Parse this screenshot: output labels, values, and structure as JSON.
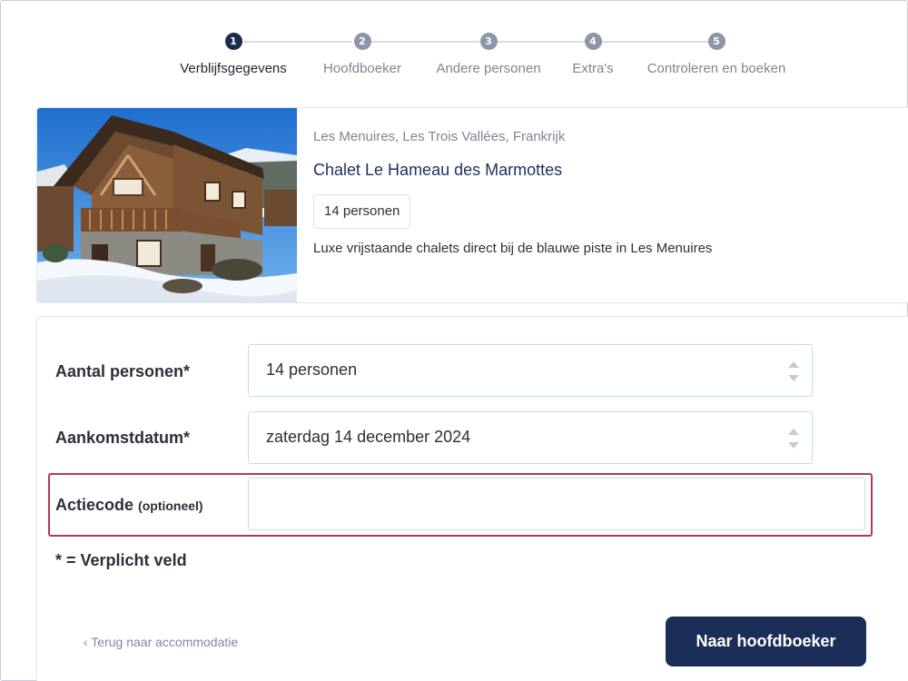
{
  "stepper": {
    "steps": [
      {
        "number": "1",
        "label": "Verblijfsgegevens",
        "active": true
      },
      {
        "number": "2",
        "label": "Hoofdboeker",
        "active": false
      },
      {
        "number": "3",
        "label": "Andere personen",
        "active": false
      },
      {
        "number": "4",
        "label": "Extra's",
        "active": false
      },
      {
        "number": "5",
        "label": "Controleren en boeken",
        "active": false
      }
    ]
  },
  "accommodation": {
    "location": "Les Menuires, Les Trois Vallées, Frankrijk",
    "name": "Chalet Le Hameau des Marmottes",
    "capacity": "14 personen",
    "description": "Luxe vrijstaande chalets direct bij de blauwe piste in Les Menuires"
  },
  "form": {
    "persons_label": "Aantal personen*",
    "persons_value": "14 personen",
    "arrival_label": "Aankomstdatum*",
    "arrival_value": "zaterdag 14 december 2024",
    "promo_label": "Actiecode",
    "promo_optional": "(optioneel)",
    "promo_value": "",
    "required_note": "* = Verplicht veld",
    "back_link": "‹ Terug naar accommodatie",
    "next_button": "Naar hoofdboeker"
  },
  "colors": {
    "primary": "#1c2e57",
    "highlight_border": "#b03b55",
    "link": "#7c8aa5"
  },
  "icons": {
    "spinner": "up-down-arrows-icon"
  }
}
